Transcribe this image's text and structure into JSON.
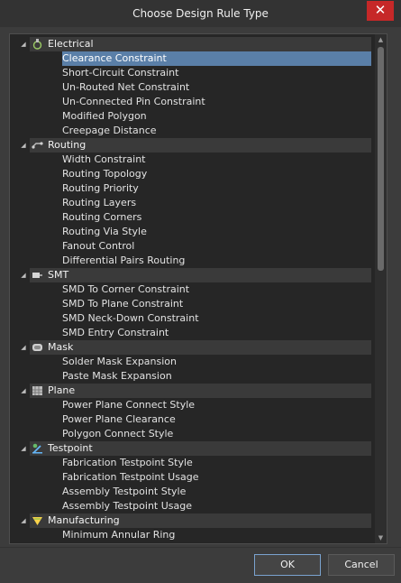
{
  "window": {
    "title": "Choose Design Rule Type",
    "close_glyph": "✕"
  },
  "groups": [
    {
      "name": "Electrical",
      "icon": "electrical-icon",
      "items": [
        "Clearance Constraint",
        "Short-Circuit Constraint",
        "Un-Routed Net Constraint",
        "Un-Connected Pin Constraint",
        "Modified Polygon",
        "Creepage Distance"
      ]
    },
    {
      "name": "Routing",
      "icon": "routing-icon",
      "items": [
        "Width Constraint",
        "Routing Topology",
        "Routing Priority",
        "Routing Layers",
        "Routing Corners",
        "Routing Via Style",
        "Fanout Control",
        "Differential Pairs Routing"
      ]
    },
    {
      "name": "SMT",
      "icon": "smt-icon",
      "items": [
        "SMD To Corner Constraint",
        "SMD To Plane Constraint",
        "SMD Neck-Down Constraint",
        "SMD Entry Constraint"
      ]
    },
    {
      "name": "Mask",
      "icon": "mask-icon",
      "items": [
        "Solder Mask Expansion",
        "Paste Mask Expansion"
      ]
    },
    {
      "name": "Plane",
      "icon": "plane-icon",
      "items": [
        "Power Plane Connect Style",
        "Power Plane Clearance",
        "Polygon Connect Style"
      ]
    },
    {
      "name": "Testpoint",
      "icon": "testpoint-icon",
      "items": [
        "Fabrication Testpoint Style",
        "Fabrication Testpoint Usage",
        "Assembly Testpoint Style",
        "Assembly Testpoint Usage"
      ]
    },
    {
      "name": "Manufacturing",
      "icon": "manufacturing-icon",
      "items": [
        "Minimum Annular Ring"
      ]
    }
  ],
  "selected": "Clearance Constraint",
  "buttons": {
    "ok": "OK",
    "cancel": "Cancel"
  },
  "colors": {
    "selection": "#5a7fa8",
    "background": "#262626",
    "group_header": "#3a3a3a"
  }
}
